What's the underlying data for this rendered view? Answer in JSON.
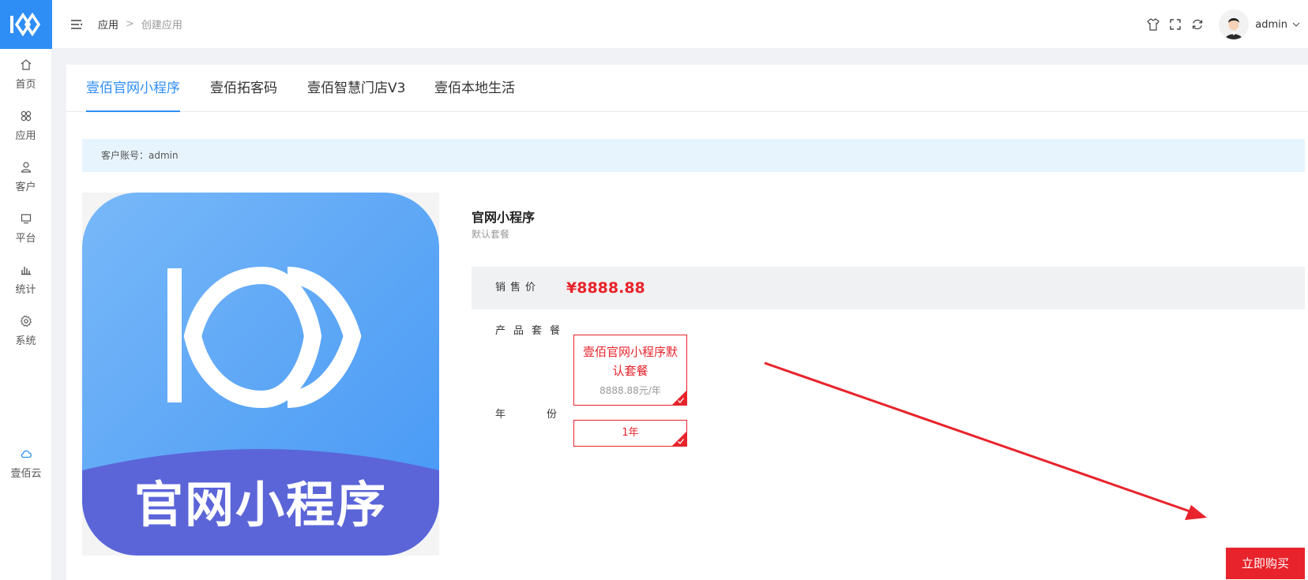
{
  "sidebar": {
    "logo": "yibai-logo",
    "items": [
      {
        "label": "首页",
        "icon": "home-icon"
      },
      {
        "label": "应用",
        "icon": "apps-icon"
      },
      {
        "label": "客户",
        "icon": "user-icon"
      },
      {
        "label": "平台",
        "icon": "monitor-icon"
      },
      {
        "label": "统计",
        "icon": "bar-chart-icon"
      },
      {
        "label": "系统",
        "icon": "gear-icon"
      }
    ],
    "cloud": {
      "label": "壹佰云",
      "icon": "cloud-icon"
    }
  },
  "header": {
    "breadcrumb": {
      "root": "应用",
      "separator": ">",
      "current": "创建应用"
    },
    "icons": [
      "shirt-icon",
      "fullscreen-icon",
      "refresh-icon"
    ],
    "username": "admin"
  },
  "tabs": [
    {
      "label": "壹佰官网小程序",
      "active": true
    },
    {
      "label": "壹佰拓客码",
      "active": false
    },
    {
      "label": "壹佰智慧门店V3",
      "active": false
    },
    {
      "label": "壹佰本地生活",
      "active": false
    }
  ],
  "account": {
    "text": "客户账号：admin"
  },
  "product": {
    "image_caption": "官网小程序",
    "title": "官网小程序",
    "subtitle": "默认套餐",
    "price_label": "销售价",
    "price": "¥8888.88",
    "package_label": "产品套餐",
    "package_name": "壹佰官网小程序默认套餐",
    "package_price": "8888.88元/年",
    "year_label": "年份",
    "year_value": "1年",
    "buy_label": "立即购买"
  },
  "colors": {
    "accent": "#2f8ef5",
    "danger": "#e8232b",
    "image_gradient_top": "#6db2f7",
    "image_gradient_bottom": "#4e9cf5",
    "image_band": "#5b65d8"
  }
}
